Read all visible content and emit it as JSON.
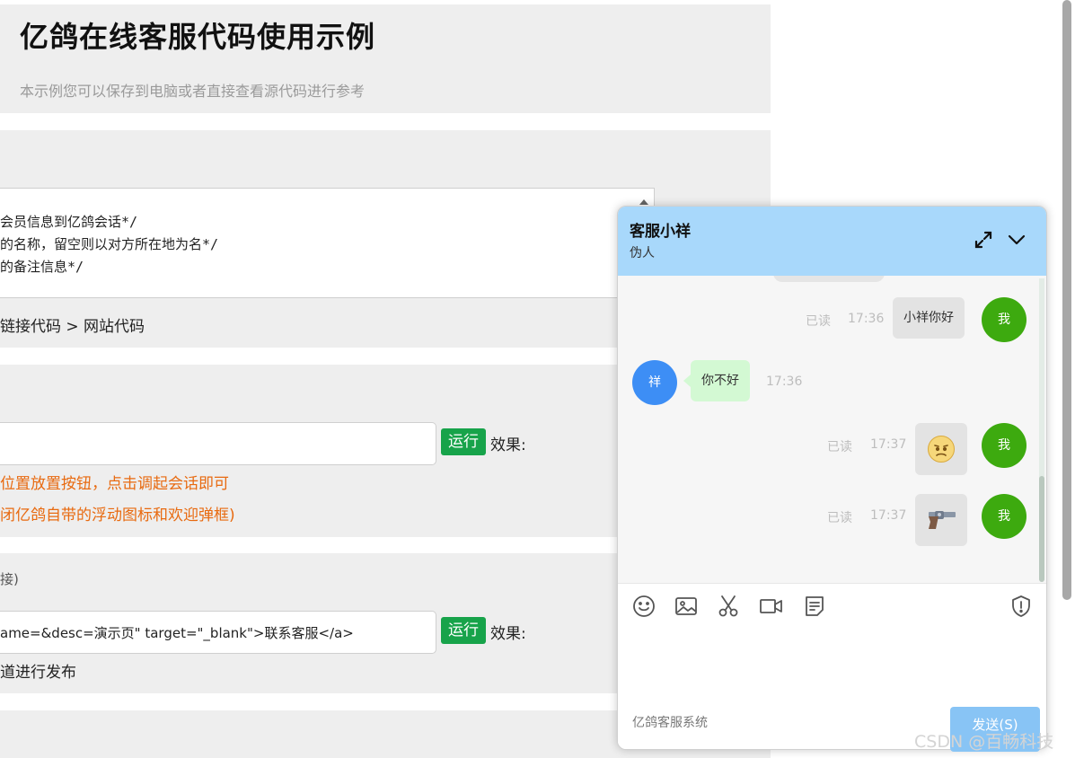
{
  "page": {
    "title": "亿鸽在线客服代码使用示例",
    "subtitle": "本示例您可以保存到电脑或者直接查看源代码进行参考",
    "code_lines": [
      "会员信息到亿鸽会话*/",
      "的名称，留空则以对方所在地为名*/",
      "的备注信息*/"
    ],
    "code_path": "链接代码 > 网站代码",
    "section2": {
      "input_value": "",
      "run_label": "运行",
      "effect_label": "效果:",
      "note1": "位置放置按钮，点击调起会话即可",
      "note2": "闭亿鸽自带的浮动图标和欢迎弹框)"
    },
    "section3": {
      "heading_fragment": "接)",
      "input_value": "ame=&desc=演示页\" target=\"_blank\">联系客服</a>",
      "run_label": "运行",
      "effect_label": "效果:",
      "note": "道进行发布"
    }
  },
  "chat": {
    "header": {
      "title": "客服小祥",
      "subtitle": "伪人",
      "expand_icon": "expand-icon",
      "collapse_icon": "chevron-down-icon",
      "color": "#a8d8fb"
    },
    "messages": [
      {
        "side": "right",
        "status": "已读",
        "time": "17:36",
        "text": "小祥你好",
        "avatar": "我"
      },
      {
        "side": "left",
        "time": "17:36",
        "text": "你不好",
        "avatar": "祥"
      },
      {
        "side": "right",
        "status": "已读",
        "time": "17:37",
        "emoji": "😟",
        "avatar": "我"
      },
      {
        "side": "right",
        "status": "已读",
        "time": "17:37",
        "emoji": "🔫",
        "avatar": "我"
      }
    ],
    "toolbar": [
      "smile-icon",
      "image-icon",
      "scissors-icon",
      "video-icon",
      "note-icon",
      "shield-icon"
    ],
    "footer_label": "亿鸽客服系统",
    "send_label": "发送(S)",
    "colors": {
      "my_avatar": "#3daa0f",
      "agent_avatar": "#3d8ef5",
      "agent_bubble": "#d3f9d3",
      "my_bubble": "#e3e3e3"
    }
  },
  "watermark": "CSDN @百畅科技"
}
